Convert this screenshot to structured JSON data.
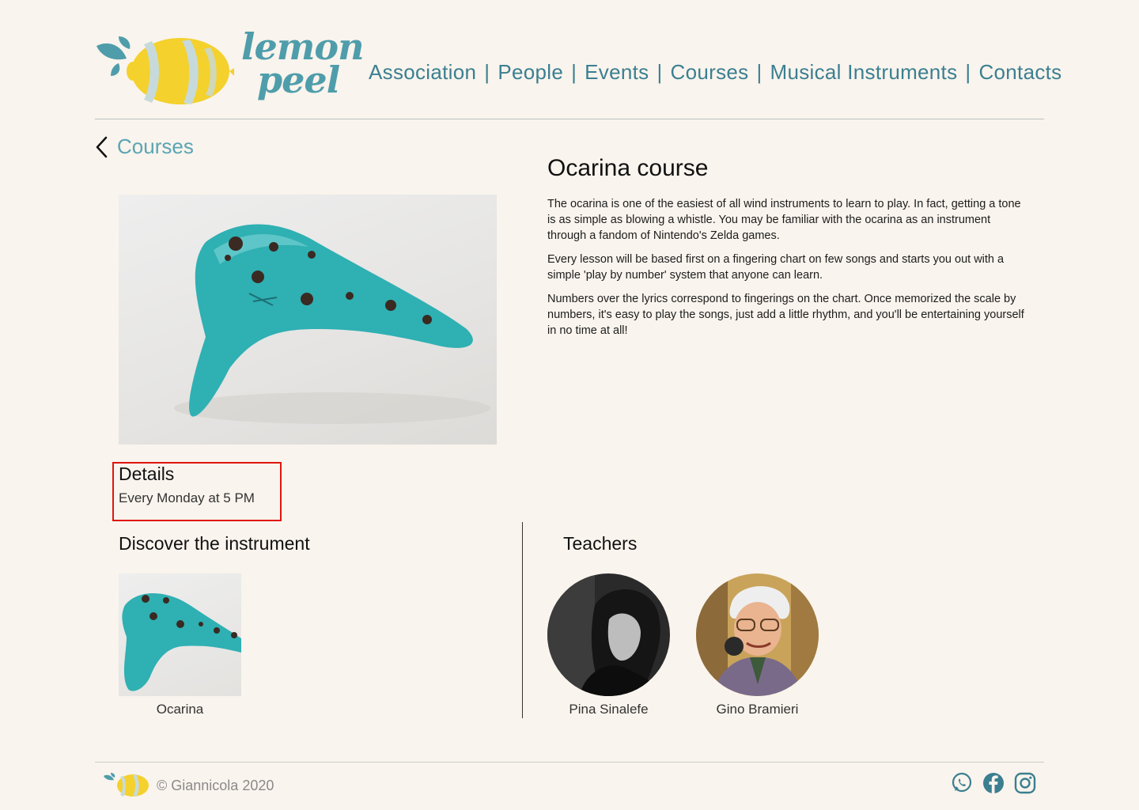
{
  "brand": {
    "name_line1": "lemon",
    "name_line2": "peel",
    "accent": "#4f9dab",
    "lemon_yellow": "#f4d12c"
  },
  "nav": {
    "items": [
      "Association",
      "People",
      "Events",
      "Courses",
      "Musical Instruments",
      "Contacts"
    ],
    "separator": "|"
  },
  "back": {
    "label": "Courses",
    "icon": "chevron-left-icon"
  },
  "course": {
    "title": "Ocarina course",
    "paragraphs": [
      "The ocarina is one of the easiest of all wind instruments to learn to play. In fact, getting a tone is as simple as blowing a whistle. You may be familiar with the ocarina as an instrument through a fandom of Nintendo's Zelda games.",
      "Every lesson will be based first on a fingering chart on few songs and starts you out with a simple 'play by number' system that anyone can learn.",
      "Numbers over the lyrics correspond to fingerings on the chart. Once memorized the scale by numbers, it's easy to play the songs, just add a little rhythm, and you'll be entertaining yourself in no time at all!"
    ]
  },
  "details": {
    "title": "Details",
    "schedule": "Every Monday at 5 PM"
  },
  "discover": {
    "title": "Discover the instrument",
    "instrument_name": "Ocarina"
  },
  "teachers": {
    "title": "Teachers",
    "list": [
      {
        "name": "Pina Sinalefe"
      },
      {
        "name": "Gino Bramieri"
      }
    ]
  },
  "footer": {
    "copyright": "© Giannicola 2020",
    "social_icons": [
      "whatsapp-icon",
      "facebook-icon",
      "instagram-icon"
    ]
  }
}
